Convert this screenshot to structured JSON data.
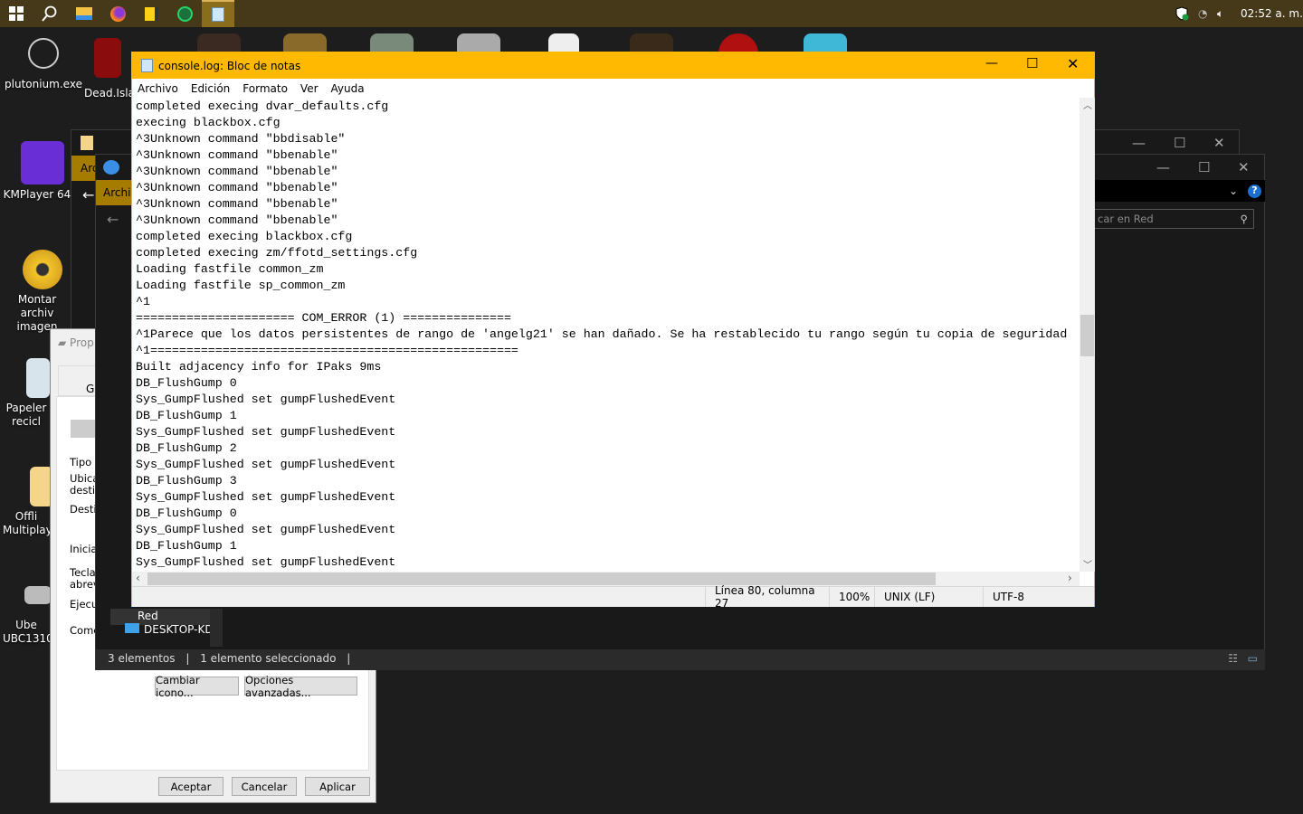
{
  "taskbar": {
    "apps": [
      {
        "icon": "windows-start-icon"
      },
      {
        "icon": "search-icon"
      },
      {
        "icon": "file-explorer-icon"
      },
      {
        "icon": "firefox-icon"
      },
      {
        "icon": "sticky-notes-icon"
      },
      {
        "icon": "whatsapp-icon"
      },
      {
        "icon": "notepad-icon",
        "active": true
      }
    ],
    "clock": "02:52 a. m.",
    "accent": "#45391a"
  },
  "desktop": {
    "icons": [
      {
        "label": "plutonium.exe"
      },
      {
        "label": "Dead.Isla"
      },
      {
        "label": "KMPlayer 64"
      },
      {
        "label": "Montar archiv imagen"
      },
      {
        "label": "Papeler recicl"
      },
      {
        "label": "Offli Multiplay"
      },
      {
        "label": "Ube UBC1310"
      }
    ]
  },
  "explorer": {
    "menu_label_1": "Arc",
    "menu_label_2": "Archiv",
    "search_placeholder": "car en Red",
    "nav_items": [
      "Red",
      "DESKTOP-KDH"
    ],
    "status": [
      "3 elementos",
      "1 elemento seleccionado"
    ]
  },
  "properties": {
    "title": "Prop",
    "tab": "Ge",
    "labels": [
      "Tipo d",
      "Ubica destin",
      "Destin",
      "Iniciar",
      "Tecla abrevi",
      "Ejecut",
      "Comer"
    ],
    "buttons": {
      "change_icon": "Cambiar icono...",
      "advanced": "Opciones avanzadas...",
      "ok": "Aceptar",
      "cancel": "Cancelar",
      "apply": "Aplicar"
    }
  },
  "notepad": {
    "title": "console.log: Bloc de notas",
    "accent": "#ffb900",
    "menu": [
      "Archivo",
      "Edición",
      "Formato",
      "Ver",
      "Ayuda"
    ],
    "lines": [
      "completed execing dvar_defaults.cfg",
      "execing blackbox.cfg",
      "^3Unknown command \"bbdisable\"",
      "^3Unknown command \"bbenable\"",
      "^3Unknown command \"bbenable\"",
      "^3Unknown command \"bbenable\"",
      "^3Unknown command \"bbenable\"",
      "^3Unknown command \"bbenable\"",
      "completed execing blackbox.cfg",
      "completed execing zm/ffotd_settings.cfg",
      "Loading fastfile common_zm",
      "Loading fastfile sp_common_zm",
      "^1",
      "====================== COM_ERROR (1) ===============",
      "^1Parece que los datos persistentes de rango de 'angelg21' se han dañado. Se ha restablecido tu rango según tu copia de seguridad",
      "^1===================================================",
      "Built adjacency info for IPaks 9ms",
      "DB_FlushGump 0",
      "Sys_GumpFlushed set gumpFlushedEvent",
      "DB_FlushGump 1",
      "Sys_GumpFlushed set gumpFlushedEvent",
      "DB_FlushGump 2",
      "Sys_GumpFlushed set gumpFlushedEvent",
      "DB_FlushGump 3",
      "Sys_GumpFlushed set gumpFlushedEvent",
      "DB_FlushGump 0",
      "Sys_GumpFlushed set gumpFlushedEvent",
      "DB_FlushGump 1",
      "Sys_GumpFlushed set gumpFlushedEvent"
    ],
    "status": {
      "position": "Línea 80, columna 27",
      "zoom": "100%",
      "line_ending": "UNIX (LF)",
      "encoding": "UTF-8"
    }
  }
}
